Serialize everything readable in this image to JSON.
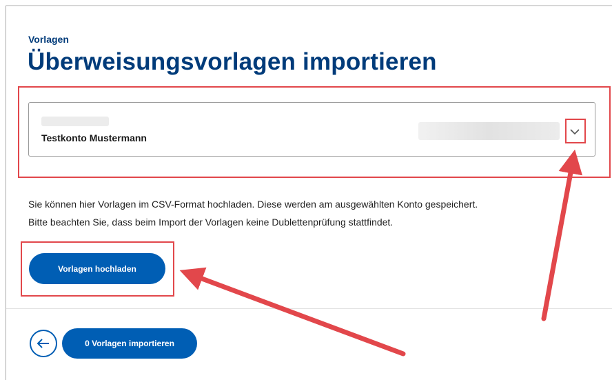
{
  "header": {
    "breadcrumb": "Vorlagen",
    "title": "Überweisungsvorlagen importieren"
  },
  "account_select": {
    "account_name": "Testkonto Mustermann",
    "icon": "chevron-down-icon"
  },
  "info": {
    "line1": "Sie können hier Vorlagen im CSV-Format hochladen. Diese werden am ausgewählten Konto gespeichert.",
    "line2": "Bitte beachten Sie, dass beim Import der Vorlagen keine Dublettenprüfung stattfindet."
  },
  "actions": {
    "upload_label": "Vorlagen hochladen",
    "import_label": "0 Vorlagen importieren",
    "back_icon": "arrow-left-icon"
  },
  "colors": {
    "primary": "#005eb4",
    "heading": "#003b7a",
    "annotation": "#e2474b"
  }
}
